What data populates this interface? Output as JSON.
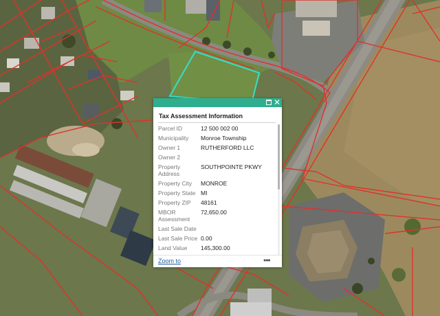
{
  "map": {
    "description": "aerial imagery with red parcel boundary lines",
    "selected_parcel_color": "#33e0c8",
    "parcel_line_color": "#e0312b"
  },
  "popup": {
    "title": "Tax Assessment Information",
    "header_color": "#2fae8f",
    "maximize_icon": "maximize-icon",
    "close_icon": "close-icon",
    "fields": [
      {
        "label": "Parcel ID",
        "value": "12 500 002 00"
      },
      {
        "label": "Municipality",
        "value": "Monroe Township"
      },
      {
        "label": "Owner 1",
        "value": "RUTHERFORD LLC"
      },
      {
        "label": "Owner 2",
        "value": ""
      },
      {
        "label": "Property Address",
        "value": "SOUTHPOINTE PKWY"
      },
      {
        "label": "Property City",
        "value": "MONROE"
      },
      {
        "label": "Property State",
        "value": "MI"
      },
      {
        "label": "Property ZIP",
        "value": "48161"
      },
      {
        "label": "MBOR Assessment",
        "value": "72,650.00"
      },
      {
        "label": "Last Sale Date",
        "value": ""
      },
      {
        "label": "Last Sale Price",
        "value": "0.00"
      },
      {
        "label": "Land Value",
        "value": "145,300.00"
      }
    ],
    "footer": {
      "zoom_label": "Zoom to",
      "more_glyph": "•••"
    }
  }
}
